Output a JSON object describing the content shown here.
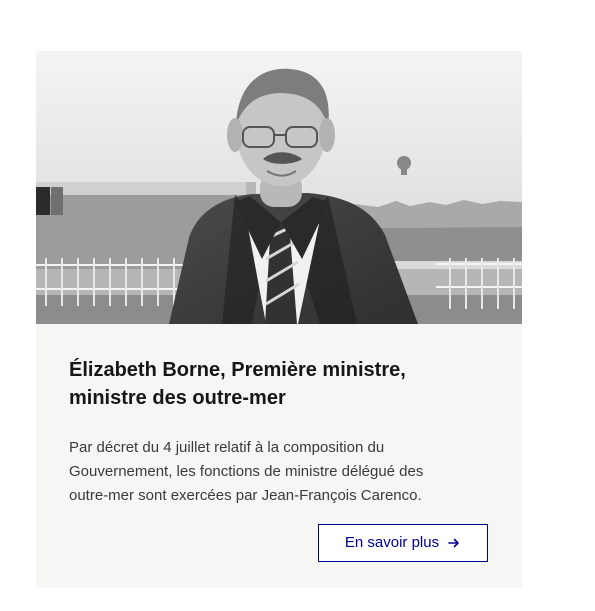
{
  "card": {
    "title_line1": "Élizabeth Borne, Première ministre,",
    "title_line2": "ministre des outre-mer",
    "description_line1": "Par décret du 4 juillet relatif à la composition du",
    "description_line2": "Gouvernement, les fonctions de ministre délégué des",
    "description_line3": "outre-mer sont exercées par Jean-François Carenco.",
    "button_label": "En savoir plus",
    "button_icon": "arrow-right-icon"
  },
  "colors": {
    "card_background": "#f6f6f5",
    "title_text": "#161616",
    "body_text": "#3a3a3a",
    "link_blue": "#000091",
    "page_background": "#ffffff"
  }
}
